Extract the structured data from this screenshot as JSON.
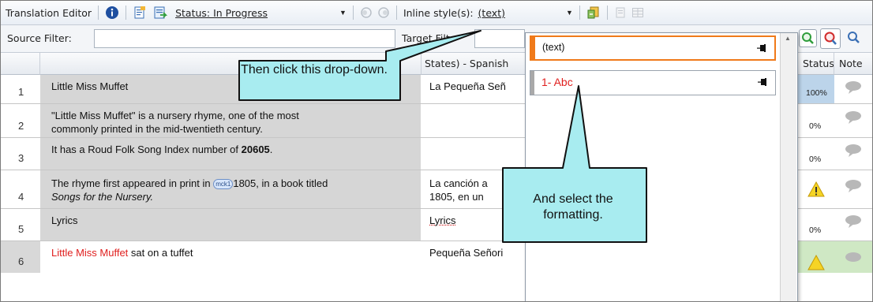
{
  "toolbar": {
    "title": "Translation Editor",
    "status_label": "Status: In Progress",
    "inline_style_label": "Inline style(s):",
    "inline_style_value": "(text)",
    "icons": [
      "info-icon",
      "open-document-icon",
      "export-icon",
      "segment-left-icon",
      "segment-right-icon",
      "insert-style-icon",
      "preview-icon",
      "grid-icon"
    ]
  },
  "filters": {
    "source_label": "Source Filter:",
    "target_label": "Target Filt",
    "icons": [
      "find-icon",
      "find-replace-icon",
      "search-icon"
    ]
  },
  "columns": {
    "target": "States) - Spanish",
    "status": "Status",
    "notes": "Note"
  },
  "rows": [
    {
      "num": "1",
      "source": "Little Miss Muffet",
      "target": "La Pequeña Señ",
      "status": "100%"
    },
    {
      "num": "2",
      "source_line1": "\"Little Miss Muffet\" is a nursery rhyme, one of the most",
      "source_line2": "commonly printed in the mid-twentieth century.",
      "target": "",
      "status": "0%"
    },
    {
      "num": "3",
      "source_prefix": "It has a Roud Folk Song Index number of ",
      "source_bold": "20605",
      "source_suffix": ".",
      "target": "",
      "status": "0%"
    },
    {
      "num": "4",
      "source_prefix": "The rhyme first appeared in print in ",
      "source_tag": "mck1",
      "source_after_tag": "1805, in a book titled",
      "source_line2": "Songs for the Nursery.",
      "target_line1": "La canción a",
      "target_line2": "1805, en un",
      "status": "warning"
    },
    {
      "num": "5",
      "source": "Lyrics",
      "target": "Lyrics",
      "status": "0%"
    },
    {
      "num": "6",
      "source_red": "Little Miss Muffet",
      "source_rest": " sat on a tuffet",
      "target": "Pequeña Señori",
      "status": "warning"
    }
  ],
  "dropdown": {
    "items": [
      {
        "label": "(text)"
      },
      {
        "label": "1- Abc"
      }
    ]
  },
  "callouts": {
    "first": "Then click this drop-down.",
    "second": "And select the formatting."
  },
  "colors": {
    "callout_fill": "#a8ecf0",
    "callout_border": "#111111",
    "orange_accent": "#f07a1a",
    "red_text": "#e0201f",
    "source_bg": "#d6d6d6"
  }
}
